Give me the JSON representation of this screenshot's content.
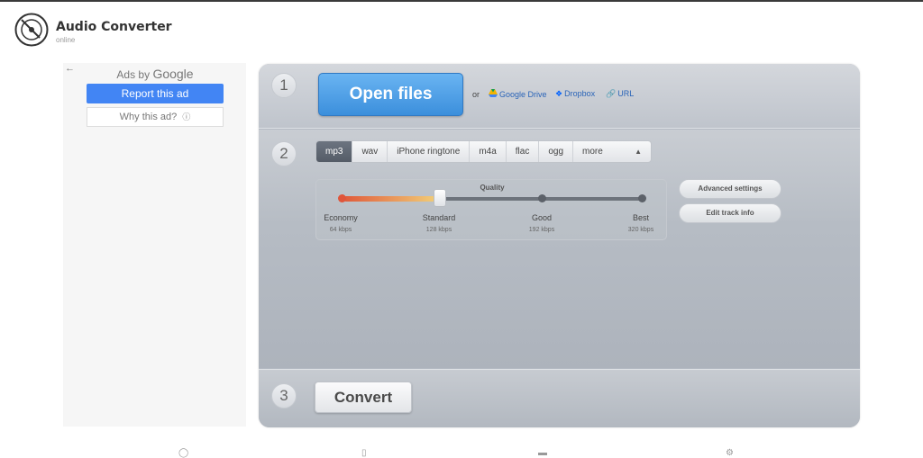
{
  "header": {
    "title": "Audio Converter",
    "subtitle": "online",
    "logo_icon": "vinyl-disc-icon"
  },
  "ad": {
    "back_icon": "arrow-left-icon",
    "ads_by": "Ads by",
    "google": "Google",
    "report_label": "Report this ad",
    "why_label": "Why this ad?",
    "info_icon": "info-circle-icon"
  },
  "steps": {
    "one": "1",
    "two": "2",
    "three": "3"
  },
  "step1": {
    "open_files": "Open files",
    "or": "or",
    "google_drive": "Google Drive",
    "dropbox": "Dropbox",
    "url": "URL"
  },
  "step2": {
    "formats": [
      "mp3",
      "wav",
      "iPhone ringtone",
      "m4a",
      "flac",
      "ogg",
      "more"
    ],
    "selected_format": "mp3",
    "quality": {
      "title": "Quality",
      "levels": [
        "Economy",
        "Standard",
        "Good",
        "Best"
      ],
      "bitrates": [
        "64 kbps",
        "128 kbps",
        "192 kbps",
        "320 kbps"
      ],
      "selected_level": "Standard",
      "slider_fraction": 0.33
    },
    "advanced_settings": "Advanced settings",
    "edit_track_info": "Edit track info"
  },
  "step3": {
    "convert": "Convert"
  },
  "colors": {
    "accent_blue": "#4285f4",
    "open_button": "#3b8fdc",
    "panel_bg": "#b3b9c2"
  }
}
